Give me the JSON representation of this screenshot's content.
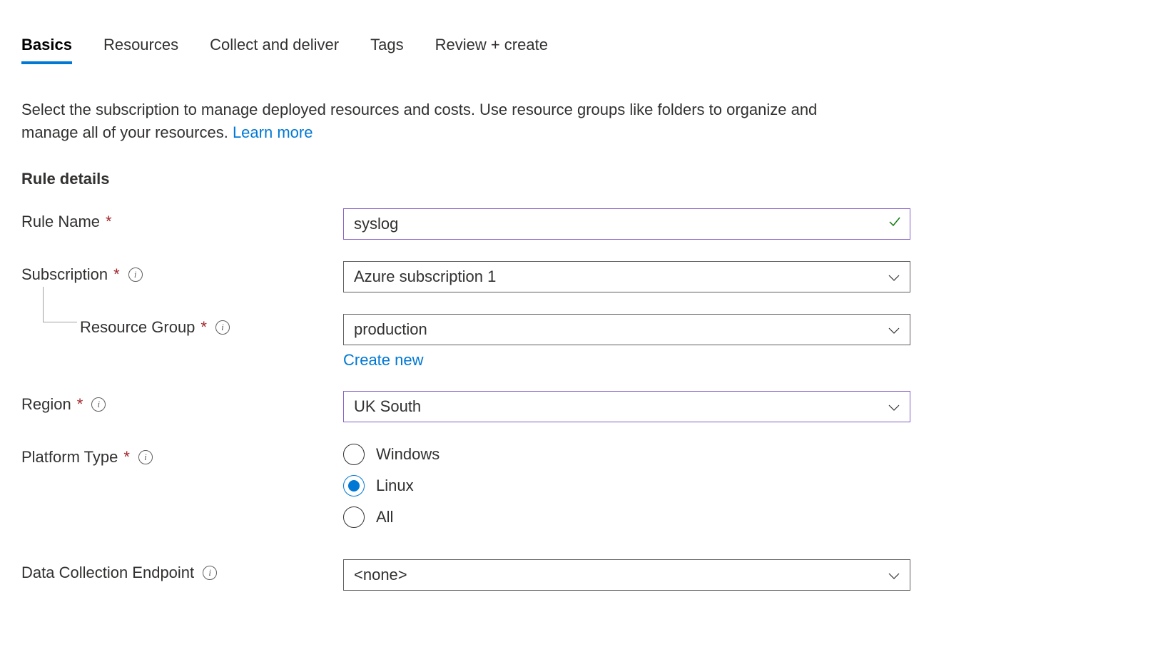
{
  "tabs": {
    "basics": "Basics",
    "resources": "Resources",
    "collect": "Collect and deliver",
    "tags": "Tags",
    "review": "Review + create"
  },
  "intro": {
    "text": "Select the subscription to manage deployed resources and costs. Use resource groups like folders to organize and manage all of your resources. ",
    "learn_more": "Learn more"
  },
  "section": {
    "rule_details": "Rule details"
  },
  "fields": {
    "rule_name": {
      "label": "Rule Name",
      "value": "syslog"
    },
    "subscription": {
      "label": "Subscription",
      "value": "Azure subscription 1"
    },
    "resource_group": {
      "label": "Resource Group",
      "value": "production",
      "create_new": "Create new"
    },
    "region": {
      "label": "Region",
      "value": "UK South"
    },
    "platform_type": {
      "label": "Platform Type",
      "options": {
        "windows": "Windows",
        "linux": "Linux",
        "all": "All"
      },
      "selected": "linux"
    },
    "endpoint": {
      "label": "Data Collection Endpoint",
      "value": "<none>"
    }
  }
}
